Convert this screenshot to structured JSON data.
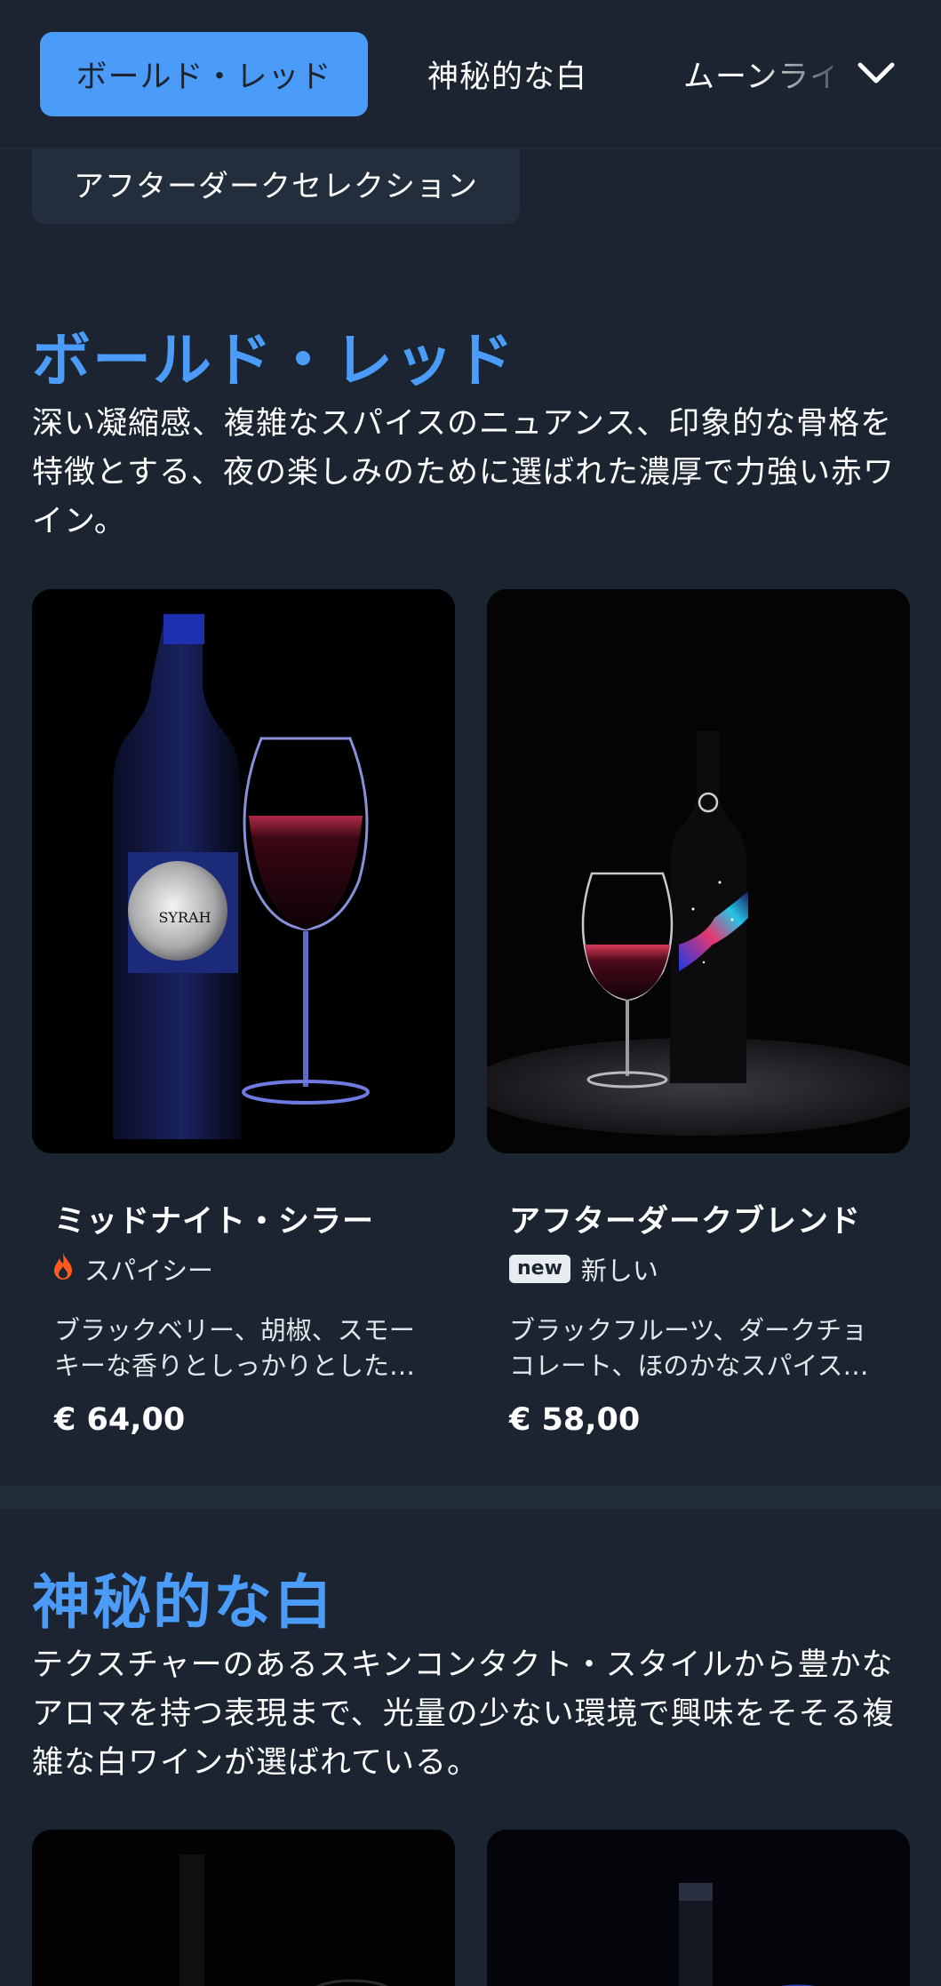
{
  "nav": {
    "tabs": [
      {
        "label": "ボールド・レッド",
        "active": true
      },
      {
        "label": "神秘的な白",
        "active": false
      },
      {
        "label": "ムーンライ",
        "active": false
      }
    ],
    "more_icon": "chevron-down-icon",
    "sub_item": "アフターダークセレクション"
  },
  "colors": {
    "accent": "#4a9cf8",
    "background": "#1b2430"
  },
  "sections": [
    {
      "title": "ボールド・レッド",
      "description": "深い凝縮感、複雑なスパイスのニュアンス、印象的な骨格を特徴とする、夜の楽しみのために選ばれた濃厚で力強い赤ワイン。",
      "products": [
        {
          "name": "ミッドナイト・シラー",
          "tag": "スパイシー",
          "tag_icon": "flame-icon",
          "description": "ブラックベリー、胡椒、スモーキーな香りとしっかりとした…",
          "price": "€ 64,00",
          "label_text": "SYRAH"
        },
        {
          "name": "アフターダークブレンド",
          "badge": "new",
          "tag": "新しい",
          "description": "ブラックフルーツ、ダークチョコレート、ほのかなスパイス…",
          "price": "€ 58,00"
        }
      ]
    },
    {
      "title": "神秘的な白",
      "description": "テクスチャーのあるスキンコンタクト・スタイルから豊かなアロマを持つ表現まで、光量の少ない環境で興味をそそる複雑な白ワインが選ばれている。"
    }
  ]
}
